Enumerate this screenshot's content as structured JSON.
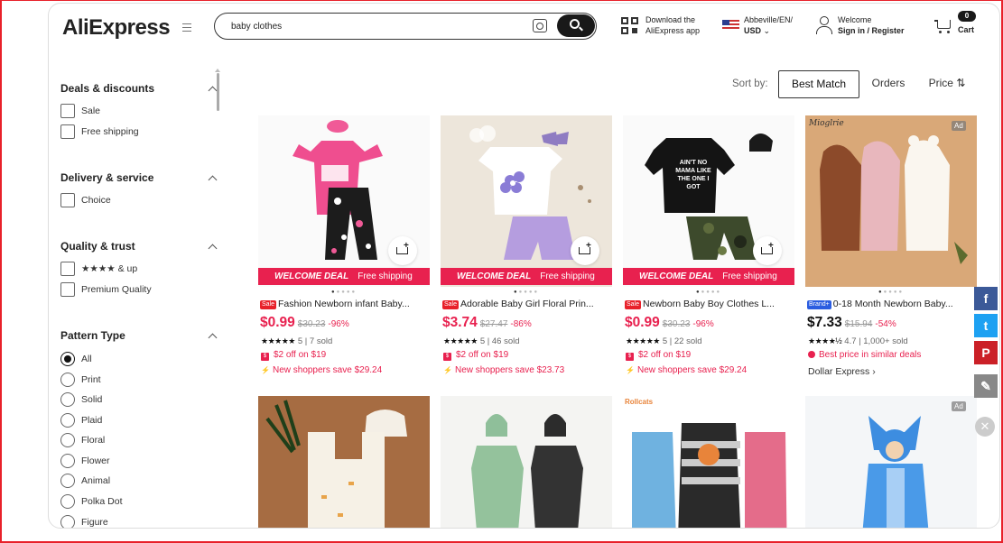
{
  "header": {
    "logo": "AliExpress",
    "search_value": "baby clothes",
    "download_line1": "Download the",
    "download_line2": "AliExpress app",
    "region_line1": "Abbeville/EN/",
    "region_line2": "USD",
    "welcome": "Welcome",
    "signin": "Sign in / Register",
    "cart_count": "0",
    "cart_label": "Cart"
  },
  "sidebar": {
    "sections": [
      {
        "title": "Deals & discounts",
        "options": [
          "Sale",
          "Free shipping"
        ]
      },
      {
        "title": "Delivery & service",
        "options": [
          "Choice"
        ]
      },
      {
        "title": "Quality & trust",
        "options": [
          "★★★★ & up",
          "Premium Quality"
        ]
      },
      {
        "title": "Pattern Type",
        "options": [
          "All",
          "Print",
          "Solid",
          "Plaid",
          "Floral",
          "Flower",
          "Animal",
          "Polka Dot",
          "Figure"
        ],
        "selected": "All"
      }
    ]
  },
  "sort": {
    "label": "Sort by:",
    "options": [
      "Best Match",
      "Orders",
      "Price"
    ],
    "active": "Best Match"
  },
  "deal_banner": {
    "title": "WELCOME DEAL",
    "text": "Free shipping"
  },
  "products": [
    {
      "tag": "Sale",
      "title": "Fashion Newborn infant Baby...",
      "price": "$0.99",
      "old_price": "$30.23",
      "discount": "-96%",
      "stars": "★★★★★",
      "rating": "5",
      "sold": "7 sold",
      "coupon": "$2 off on $19",
      "promo": "New shoppers save $29.24"
    },
    {
      "tag": "Sale",
      "title": "Adorable Baby Girl Floral Prin...",
      "price": "$3.74",
      "old_price": "$27.47",
      "discount": "-86%",
      "stars": "★★★★★",
      "rating": "5",
      "sold": "46 sold",
      "coupon": "$2 off on $19",
      "promo": "New shoppers save $23.73"
    },
    {
      "tag": "Sale",
      "title": "Newborn Baby Boy Clothes L...",
      "price": "$0.99",
      "old_price": "$30.23",
      "discount": "-96%",
      "stars": "★★★★★",
      "rating": "5",
      "sold": "22 sold",
      "coupon": "$2 off on $19",
      "promo": "New shoppers save $29.24"
    },
    {
      "tag": "Brand+",
      "title": "0-18 Month Newborn Baby...",
      "price": "$7.33",
      "old_price": "$15.94",
      "discount": "-54%",
      "stars": "★★★★½",
      "rating": "4.7",
      "sold": "1,000+ sold",
      "badge": "Best price in similar deals",
      "store": "Dollar Express",
      "ad": "Ad",
      "image_brand": "Mioglrie"
    }
  ],
  "row2_ad": "Ad",
  "row2_cartoon_logo": "Rollcats",
  "social": [
    "f",
    "t",
    "P",
    "✎"
  ],
  "colors": {
    "accent": "#e8214f",
    "brand_red": "#e8212a",
    "facebook": "#3b5998",
    "twitter": "#1da1f2",
    "pinterest": "#cb2027"
  }
}
